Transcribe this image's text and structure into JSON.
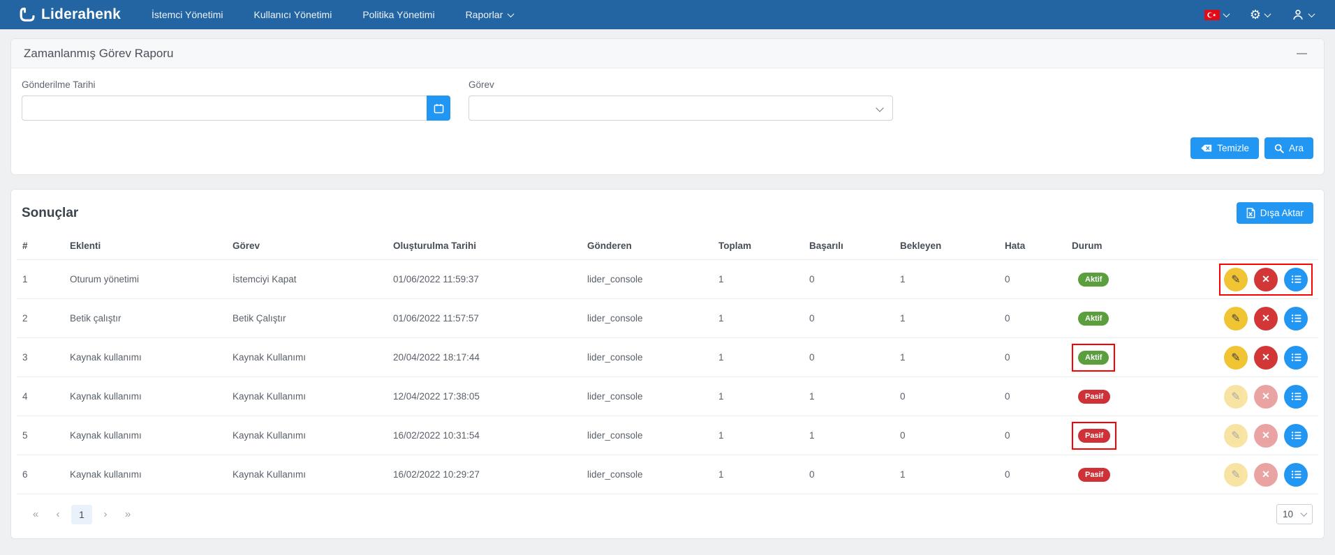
{
  "navbar": {
    "brand": "Liderahenk",
    "items": [
      "İstemci Yönetimi",
      "Kullanıcı Yönetimi",
      "Politika Yönetimi"
    ],
    "dropdown_item": "Raporlar"
  },
  "icons": {
    "gear": "⚙",
    "collapse_minus": "—",
    "pencil": "✎",
    "close": "✕"
  },
  "filter": {
    "title": "Zamanlanmış Görev Raporu",
    "date_label": "Gönderilme Tarihi",
    "date_value": "",
    "task_label": "Görev",
    "task_value": "",
    "clear_button": "Temizle",
    "search_button": "Ara"
  },
  "results": {
    "title": "Sonuçlar",
    "export_button": "Dışa Aktar",
    "columns": [
      "#",
      "Eklenti",
      "Görev",
      "Oluşturulma Tarihi",
      "Gönderen",
      "Toplam",
      "Başarılı",
      "Bekleyen",
      "Hata",
      "Durum"
    ],
    "rows": [
      {
        "n": "1",
        "eklenti": "Oturum yönetimi",
        "gorev": "İstemciyi Kapat",
        "tarih": "01/06/2022 11:59:37",
        "gonderen": "lider_console",
        "toplam": "1",
        "basarili": "0",
        "bekleyen": "1",
        "hata": "0",
        "durum": "Aktif",
        "durum_type": "aktif",
        "enabled": true,
        "highlight": "actions"
      },
      {
        "n": "2",
        "eklenti": "Betik çalıştır",
        "gorev": "Betik Çalıştır",
        "tarih": "01/06/2022 11:57:57",
        "gonderen": "lider_console",
        "toplam": "1",
        "basarili": "0",
        "bekleyen": "1",
        "hata": "0",
        "durum": "Aktif",
        "durum_type": "aktif",
        "enabled": true,
        "highlight": ""
      },
      {
        "n": "3",
        "eklenti": "Kaynak kullanımı",
        "gorev": "Kaynak Kullanımı",
        "tarih": "20/04/2022 18:17:44",
        "gonderen": "lider_console",
        "toplam": "1",
        "basarili": "0",
        "bekleyen": "1",
        "hata": "0",
        "durum": "Aktif",
        "durum_type": "aktif",
        "enabled": true,
        "highlight": "status"
      },
      {
        "n": "4",
        "eklenti": "Kaynak kullanımı",
        "gorev": "Kaynak Kullanımı",
        "tarih": "12/04/2022 17:38:05",
        "gonderen": "lider_console",
        "toplam": "1",
        "basarili": "1",
        "bekleyen": "0",
        "hata": "0",
        "durum": "Pasif",
        "durum_type": "pasif",
        "enabled": false,
        "highlight": ""
      },
      {
        "n": "5",
        "eklenti": "Kaynak kullanımı",
        "gorev": "Kaynak Kullanımı",
        "tarih": "16/02/2022 10:31:54",
        "gonderen": "lider_console",
        "toplam": "1",
        "basarili": "1",
        "bekleyen": "0",
        "hata": "0",
        "durum": "Pasif",
        "durum_type": "pasif",
        "enabled": false,
        "highlight": "status"
      },
      {
        "n": "6",
        "eklenti": "Kaynak kullanımı",
        "gorev": "Kaynak Kullanımı",
        "tarih": "16/02/2022 10:29:27",
        "gonderen": "lider_console",
        "toplam": "1",
        "basarili": "0",
        "bekleyen": "1",
        "hata": "0",
        "durum": "Pasif",
        "durum_type": "pasif",
        "enabled": false,
        "highlight": ""
      }
    ]
  },
  "pagination": {
    "first": "«",
    "prev": "‹",
    "page": "1",
    "next": "›",
    "last": "»",
    "page_size": "10"
  },
  "colors": {
    "navbar": "#2365a2",
    "accent_blue": "#2196f3",
    "badge_active": "#5b9e3d",
    "badge_passive": "#ce3238",
    "action_yellow": "#f1c433",
    "action_red": "#d23636",
    "annotation_red": "#fe0000"
  }
}
